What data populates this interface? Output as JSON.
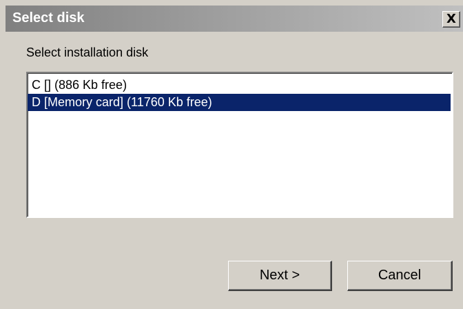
{
  "window": {
    "title": "Select disk",
    "close_label": "X"
  },
  "prompt": "Select installation disk",
  "disks": [
    {
      "label": "C [] (886 Kb free)",
      "selected": false
    },
    {
      "label": "D [Memory card] (11760 Kb free)",
      "selected": true
    }
  ],
  "buttons": {
    "next_label": "Next >",
    "cancel_label": "Cancel"
  },
  "colors": {
    "dialog_bg": "#d4d0c8",
    "selection_bg": "#0a246a",
    "selection_text": "#ffffff",
    "titlebar_inactive": "#808080"
  }
}
